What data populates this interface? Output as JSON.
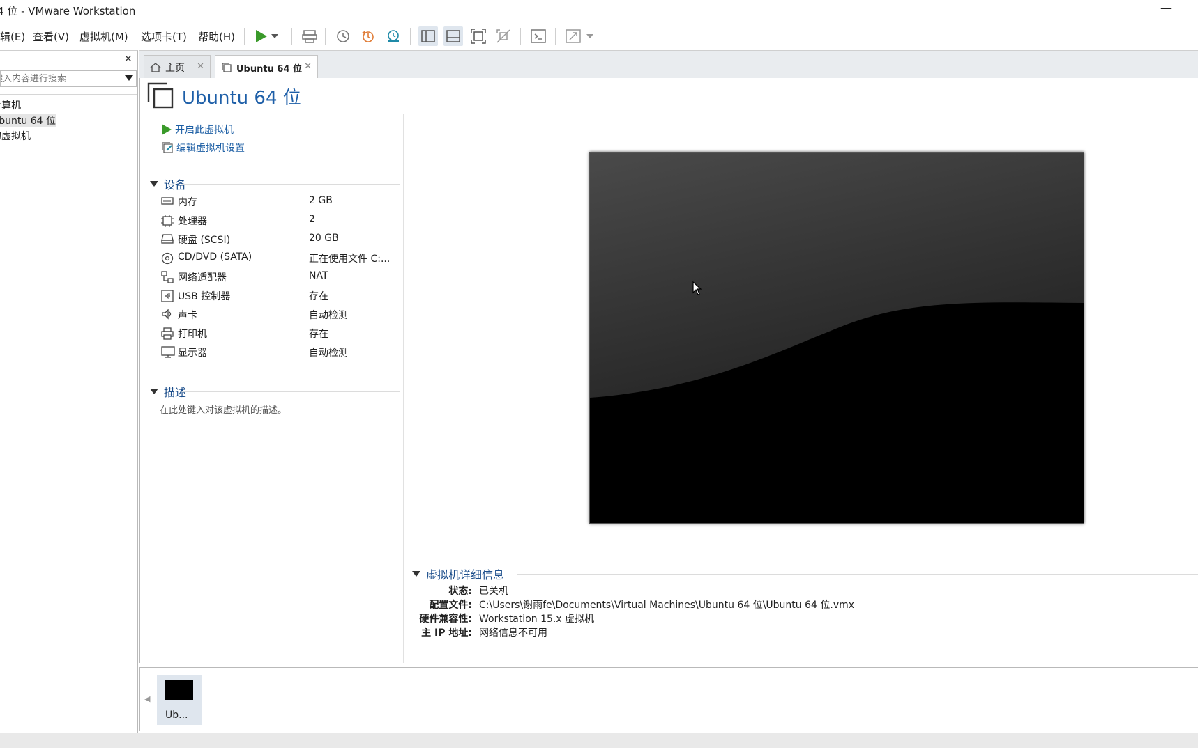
{
  "window": {
    "title": "4 位 - VMware Workstation"
  },
  "menu": {
    "items": [
      "辑(E)",
      "查看(V)",
      "虚拟机(M)",
      "选项卡(T)",
      "帮助(H)"
    ]
  },
  "toolbar": {
    "icons": [
      "play-icon",
      "dropdown-icon",
      "send-ctrl-alt-del-icon",
      "snapshot-take-icon",
      "snapshot-revert-icon",
      "snapshot-manager-icon",
      "show-library-icon",
      "show-thumbnail-bar-icon",
      "full-screen-icon",
      "unity-icon",
      "console-icon",
      "stretch-icon"
    ]
  },
  "library": {
    "search_placeholder": "键入内容进行搜索",
    "tree": [
      {
        "label": "计算机",
        "selected": false
      },
      {
        "label": "Ubuntu 64 位",
        "selected": true
      },
      {
        "label": "的虚拟机",
        "selected": false
      }
    ]
  },
  "tabs": [
    {
      "label": "主页",
      "active": false
    },
    {
      "label": "Ubuntu 64 位",
      "active": true
    }
  ],
  "vm": {
    "name": "Ubuntu 64 位",
    "actions": [
      "开启此虚拟机",
      "编辑虚拟机设置"
    ],
    "devices_title": "设备",
    "devices": [
      {
        "icon": "memory-icon",
        "name": "内存",
        "value": "2 GB"
      },
      {
        "icon": "cpu-icon",
        "name": "处理器",
        "value": "2"
      },
      {
        "icon": "hard-disk-icon",
        "name": "硬盘 (SCSI)",
        "value": "20 GB"
      },
      {
        "icon": "cd-dvd-icon",
        "name": "CD/DVD (SATA)",
        "value": "正在使用文件 C:..."
      },
      {
        "icon": "network-adapter-icon",
        "name": "网络适配器",
        "value": "NAT"
      },
      {
        "icon": "usb-icon",
        "name": "USB 控制器",
        "value": "存在"
      },
      {
        "icon": "sound-icon",
        "name": "声卡",
        "value": "自动检测"
      },
      {
        "icon": "printer-icon",
        "name": "打印机",
        "value": "存在"
      },
      {
        "icon": "display-icon",
        "name": "显示器",
        "value": "自动检测"
      }
    ],
    "description_title": "描述",
    "description_placeholder": "在此处键入对该虚拟机的描述。",
    "details_title": "虚拟机详细信息",
    "details": [
      {
        "key": "状态:",
        "value": "已关机"
      },
      {
        "key": "配置文件:",
        "value": "C:\\Users\\谢雨fe\\Documents\\Virtual Machines\\Ubuntu 64 位\\Ubuntu 64 位.vmx"
      },
      {
        "key": "硬件兼容性:",
        "value": "Workstation 15.x 虚拟机"
      },
      {
        "key": "主 IP 地址:",
        "value": "网络信息不可用"
      }
    ]
  },
  "thumbnail": {
    "label": "Ub..."
  },
  "colors": {
    "accent": "#1e5fa8",
    "play_green": "#3a9a2a",
    "link_blue": "#1c5ea4"
  }
}
